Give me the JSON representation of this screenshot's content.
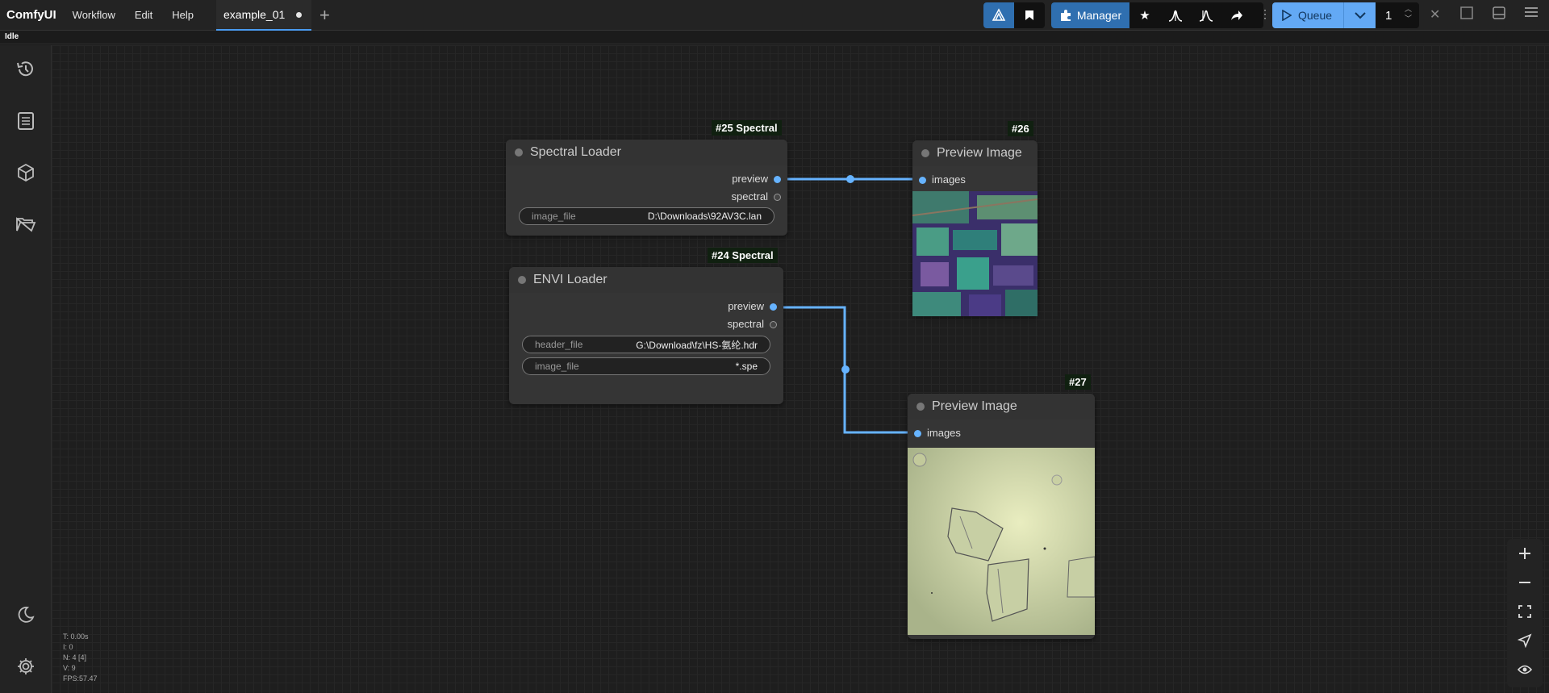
{
  "app": {
    "brand": "ComfyUI",
    "menu": [
      "Workflow",
      "Edit",
      "Help"
    ]
  },
  "tabs": [
    {
      "label": "example_01",
      "modified": true
    }
  ],
  "status": "Idle",
  "toolbar": {
    "manager_label": "Manager",
    "queue_label": "Queue",
    "queue_count": "1",
    "accent": "#63a9f5"
  },
  "sidebar": {
    "items": [
      "history-icon",
      "node-library-icon",
      "model-library-icon",
      "workflows-icon",
      "theme-toggle-icon",
      "settings-icon"
    ]
  },
  "nodes": {
    "spectral_loader": {
      "badge": "#25 Spectral",
      "title": "Spectral Loader",
      "outputs": [
        "preview",
        "spectral"
      ],
      "widgets": [
        {
          "label": "image_file",
          "value": "D:\\Downloads\\92AV3C.lan"
        }
      ]
    },
    "envi_loader": {
      "badge": "#24 Spectral",
      "title": "ENVI Loader",
      "outputs": [
        "preview",
        "spectral"
      ],
      "widgets": [
        {
          "label": "header_file",
          "value": "G:\\Download\\fz\\HS-氨纶.hdr"
        },
        {
          "label": "image_file",
          "value": "*.spe"
        }
      ]
    },
    "preview_26": {
      "badge": "#26",
      "title": "Preview Image",
      "input": "images"
    },
    "preview_27": {
      "badge": "#27",
      "title": "Preview Image",
      "input": "images"
    }
  },
  "stats": {
    "t": "T: 0.00s",
    "i": "I: 0",
    "n": "N: 4 [4]",
    "v": "V: 9",
    "fps": "FPS:57.47"
  }
}
